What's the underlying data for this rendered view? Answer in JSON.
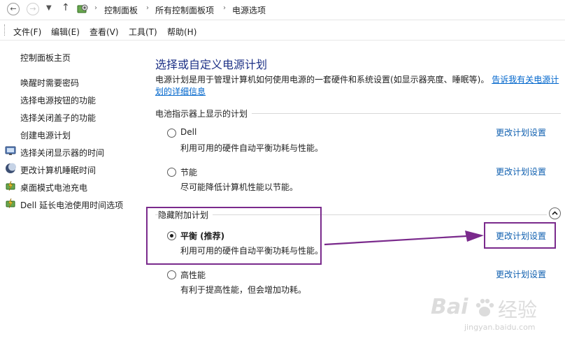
{
  "address_bar": {
    "breadcrumbs": [
      "控制面板",
      "所有控制面板项",
      "电源选项"
    ],
    "back_icon": "back-arrow-icon",
    "forward_icon": "forward-arrow-icon",
    "up_icon": "up-arrow-icon"
  },
  "menu": {
    "items": [
      "文件(F)",
      "编辑(E)",
      "查看(V)",
      "工具(T)",
      "帮助(H)"
    ]
  },
  "sidebar": {
    "home": "控制面板主页",
    "links": [
      {
        "label": "唤醒时需要密码"
      },
      {
        "label": "选择电源按钮的功能"
      },
      {
        "label": "选择关闭盖子的功能"
      },
      {
        "label": "创建电源计划"
      },
      {
        "label": "选择关闭显示器的时间",
        "icon": "monitor-icon"
      },
      {
        "label": "更改计算机睡眠时间",
        "icon": "moon-icon"
      },
      {
        "label": "桌面模式电池充电",
        "icon": "battery-icon"
      },
      {
        "label": "Dell 延长电池使用时间选项",
        "icon": "battery-icon"
      }
    ]
  },
  "main": {
    "title": "选择或自定义电源计划",
    "description_line1": "电源计划是用于管理计算机如何使用电源的一套硬件和系统设置(如显示器亮度、睡眠等)。",
    "description_link": "告诉我有关电源计划的详细信息",
    "battery_section": {
      "label": "电池指示器上显示的计划",
      "plans": [
        {
          "name": "Dell",
          "desc": "利用可用的硬件自动平衡功耗与性能。",
          "link": "更改计划设置",
          "selected": false
        },
        {
          "name": "节能",
          "desc": "尽可能降低计算机性能以节能。",
          "link": "更改计划设置",
          "selected": false
        }
      ]
    },
    "hidden_section": {
      "label": "隐藏附加计划",
      "plans": [
        {
          "name": "平衡 (推荐)",
          "desc": "利用可用的硬件自动平衡功耗与性能。",
          "link": "更改计划设置",
          "selected": true
        },
        {
          "name": "高性能",
          "desc": "有利于提高性能，但会增加功耗。",
          "link": "更改计划设置",
          "selected": false
        }
      ]
    }
  },
  "watermark": {
    "brand": "Bai",
    "suffix": "经验",
    "url": "jingyan.baidu.com"
  },
  "colors": {
    "title": "#1e3287",
    "link": "#1060b0",
    "annotation": "#7a2a8c"
  }
}
